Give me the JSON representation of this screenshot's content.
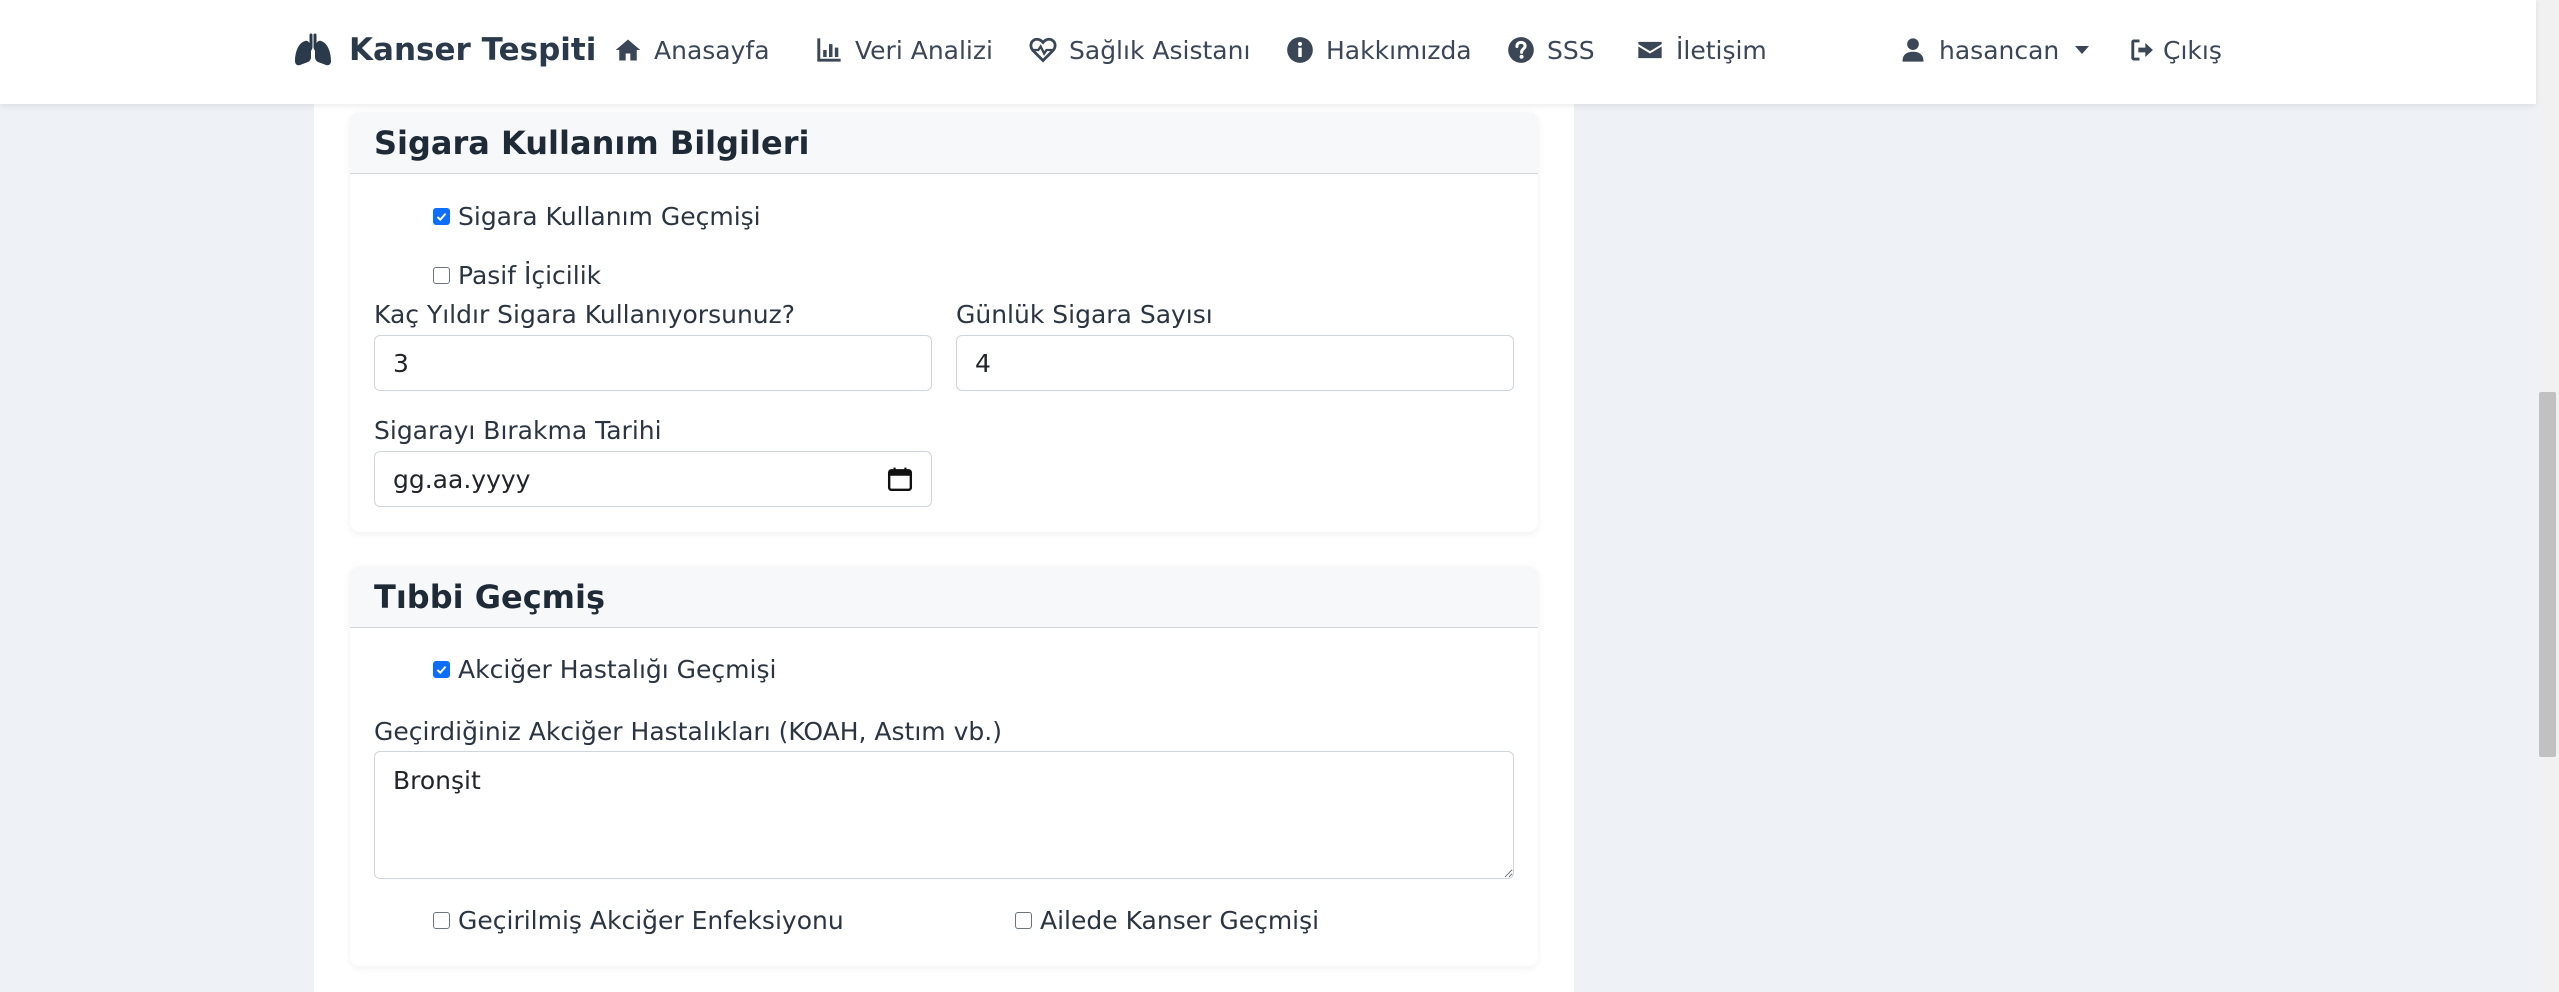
{
  "navbar": {
    "brand": "Kanser Tespiti",
    "items": [
      {
        "label": "Anasayfa",
        "icon": "home-icon"
      },
      {
        "label": "Veri Analizi",
        "icon": "chart-icon"
      },
      {
        "label": "Sağlık Asistanı",
        "icon": "heart-pulse-icon"
      },
      {
        "label": "Hakkımızda",
        "icon": "info-icon"
      },
      {
        "label": "SSS",
        "icon": "question-icon"
      },
      {
        "label": "İletişim",
        "icon": "envelope-icon"
      }
    ],
    "user": "hasancan",
    "logout": "Çıkış"
  },
  "smoking_section": {
    "title": "Sigara Kullanım Bilgileri",
    "smoking_history": {
      "label": "Sigara Kullanım Geçmişi",
      "checked": true
    },
    "passive_smoking": {
      "label": "Pasif İçicilik",
      "checked": false
    },
    "years_label": "Kaç Yıldır Sigara Kullanıyorsunuz?",
    "years_value": "3",
    "daily_label": "Günlük Sigara Sayısı",
    "daily_value": "4",
    "quit_date_label": "Sigarayı Bırakma Tarihi",
    "quit_date_placeholder": "gg.aa.yyyy"
  },
  "medical_section": {
    "title": "Tıbbi Geçmiş",
    "lung_disease_history": {
      "label": "Akciğer Hastalığı Geçmişi",
      "checked": true
    },
    "lung_diseases_label": "Geçirdiğiniz Akciğer Hastalıkları (KOAH, Astım vb.)",
    "lung_diseases_value": "Bronşit",
    "past_infection": {
      "label": "Geçirilmiş Akciğer Enfeksiyonu",
      "checked": false
    },
    "family_cancer": {
      "label": "Ailede Kanser Geçmişi",
      "checked": false
    }
  },
  "colors": {
    "accent": "#0d6efd",
    "text": "#22303f",
    "background": "#eef1f6"
  }
}
